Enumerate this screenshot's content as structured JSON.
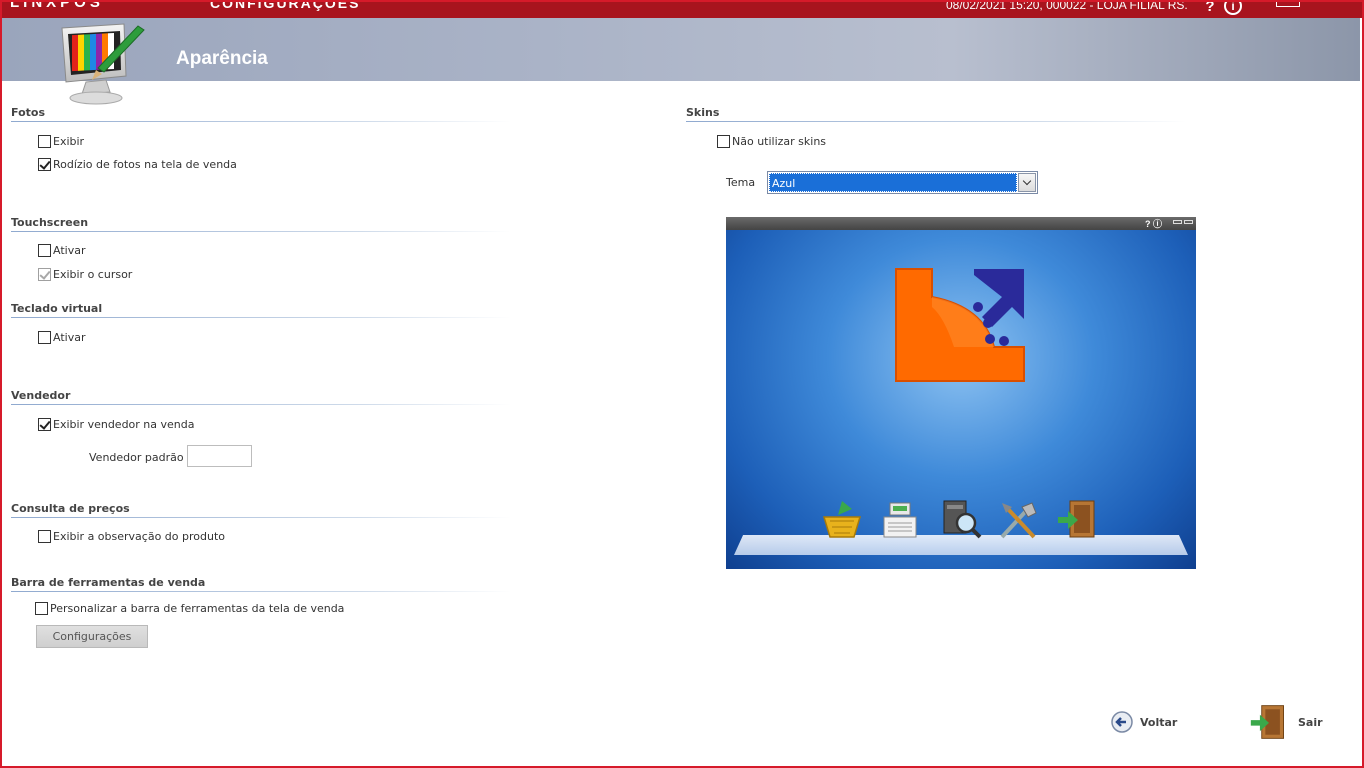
{
  "topbar": {
    "brand": "LINXPOS",
    "module": "CONFIGURAÇÕES",
    "status": "08/02/2021 15:20, 000022 - LOJA FILIAL RS.",
    "help_glyph": "?",
    "info_glyph": "i"
  },
  "header": {
    "title": "Aparência"
  },
  "fotos": {
    "title": "Fotos",
    "exibir": {
      "label": "Exibir",
      "checked": false
    },
    "rodizio": {
      "label": "Rodízio de fotos na tela de venda",
      "checked": true
    }
  },
  "touchscreen": {
    "title": "Touchscreen",
    "ativar": {
      "label": "Ativar",
      "checked": false
    },
    "cursor": {
      "label": "Exibir o cursor",
      "checked": true,
      "disabled": true
    }
  },
  "teclado": {
    "title": "Teclado virtual",
    "ativar": {
      "label": "Ativar",
      "checked": false
    }
  },
  "vendedor": {
    "title": "Vendedor",
    "exibir": {
      "label": "Exibir vendedor na venda",
      "checked": true
    },
    "padrao_label": "Vendedor padrão",
    "padrao_value": ""
  },
  "consulta": {
    "title": "Consulta de preços",
    "observacao": {
      "label": "Exibir a observação do produto",
      "checked": false
    }
  },
  "barra": {
    "title": "Barra de ferramentas de venda",
    "personalizar": {
      "label": "Personalizar a barra de ferramentas da tela de venda",
      "checked": false
    },
    "config_button": "Configurações"
  },
  "skins": {
    "title": "Skins",
    "nao_utilizar": {
      "label": "Não utilizar skins",
      "checked": false
    },
    "tema_label": "Tema",
    "tema_value": "Azul",
    "preview_bar_glyphs": "? ⓘ"
  },
  "footer": {
    "voltar": "Voltar",
    "sair": "Sair"
  },
  "colors": {
    "topbar": "#a8141e",
    "frame": "#d61a2a",
    "select_highlight": "#1a6fd8",
    "logo_orange": "#ff6a00",
    "logo_blue": "#2a2a9a"
  },
  "icons": [
    "monitor-palette-icon",
    "help-icon",
    "info-icon",
    "minimize-icon",
    "chevron-down-icon",
    "basket-icon",
    "cash-register-icon",
    "search-computer-icon",
    "tools-icon",
    "exit-door-icon",
    "back-arrow-icon"
  ]
}
